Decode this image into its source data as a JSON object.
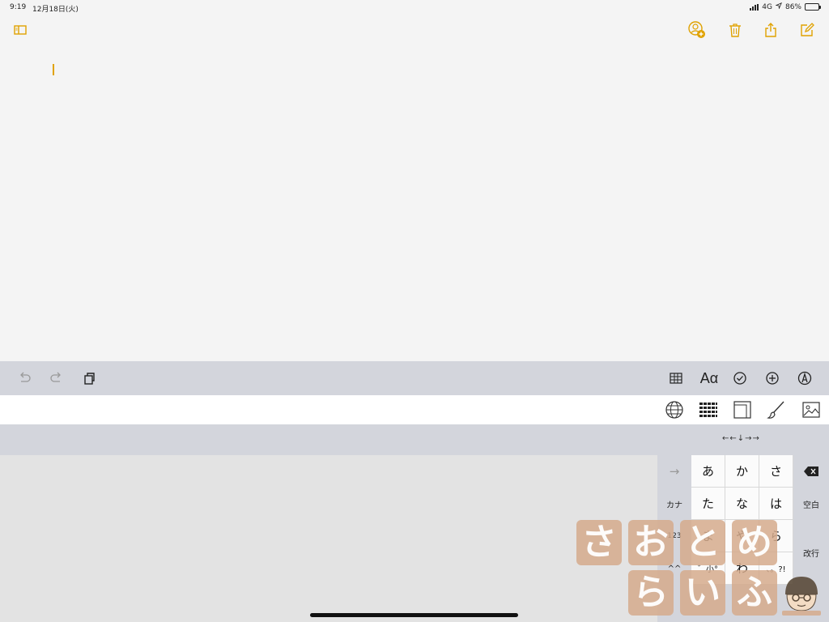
{
  "status_bar": {
    "time": "9:19",
    "date": "12月18日(火)",
    "network": "4G",
    "battery": "86%",
    "battery_level": 0.86
  },
  "note": {
    "toolbar_icons": [
      "sidebar-toggle-icon",
      "add-person-icon",
      "trash-icon",
      "share-icon",
      "compose-icon"
    ],
    "body_text": ""
  },
  "format_bar": {
    "aa_label": "Aα",
    "icons": [
      "undo-icon",
      "redo-icon",
      "paste-icon",
      "table-icon",
      "text-style-icon",
      "checklist-icon",
      "add-icon",
      "markup-icon"
    ]
  },
  "keyboard_toolbar": {
    "icons": [
      "globe-icon",
      "keypad-grid-icon",
      "scan-icon",
      "brush-icon",
      "photo-icon"
    ]
  },
  "candidate_bar": {
    "arrow_hint": "←←↓→→"
  },
  "keyboard": {
    "left_keys": [
      "→",
      "カナ",
      "123",
      "^^"
    ],
    "grid": [
      [
        "あ",
        "か",
        "さ"
      ],
      [
        "た",
        "な",
        "は"
      ],
      [
        "ま",
        "や",
        "ら"
      ],
      [
        "゛小°",
        "わ",
        "、。?!"
      ]
    ],
    "right_keys": [
      "⌫",
      "空白",
      "改行"
    ]
  },
  "watermark": {
    "row1": [
      "さ",
      "お",
      "と",
      "め"
    ],
    "row2": [
      "ら",
      "い",
      "ふ"
    ]
  },
  "colors": {
    "accent": "#e0a200",
    "toolbar_bg": "#d3d5dc",
    "note_bg": "#f4f4f4"
  }
}
